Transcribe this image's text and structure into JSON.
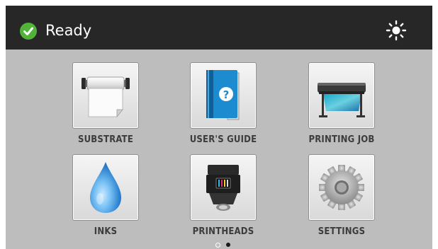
{
  "status": {
    "text": "Ready",
    "icon": "check-circle-icon",
    "color": "#52b33a"
  },
  "header": {
    "brightness_icon": "sun-icon"
  },
  "tiles": [
    {
      "label": "SUBSTRATE",
      "icon": "substrate-roll-icon"
    },
    {
      "label": "USER'S GUIDE",
      "icon": "users-guide-book-icon"
    },
    {
      "label": "PRINTING JOB",
      "icon": "printer-icon"
    },
    {
      "label": "INKS",
      "icon": "ink-drop-icon"
    },
    {
      "label": "PRINTHEADS",
      "icon": "printhead-icon"
    },
    {
      "label": "SETTINGS",
      "icon": "gear-icon"
    }
  ],
  "pagination": {
    "pages": 2,
    "current": 2
  }
}
